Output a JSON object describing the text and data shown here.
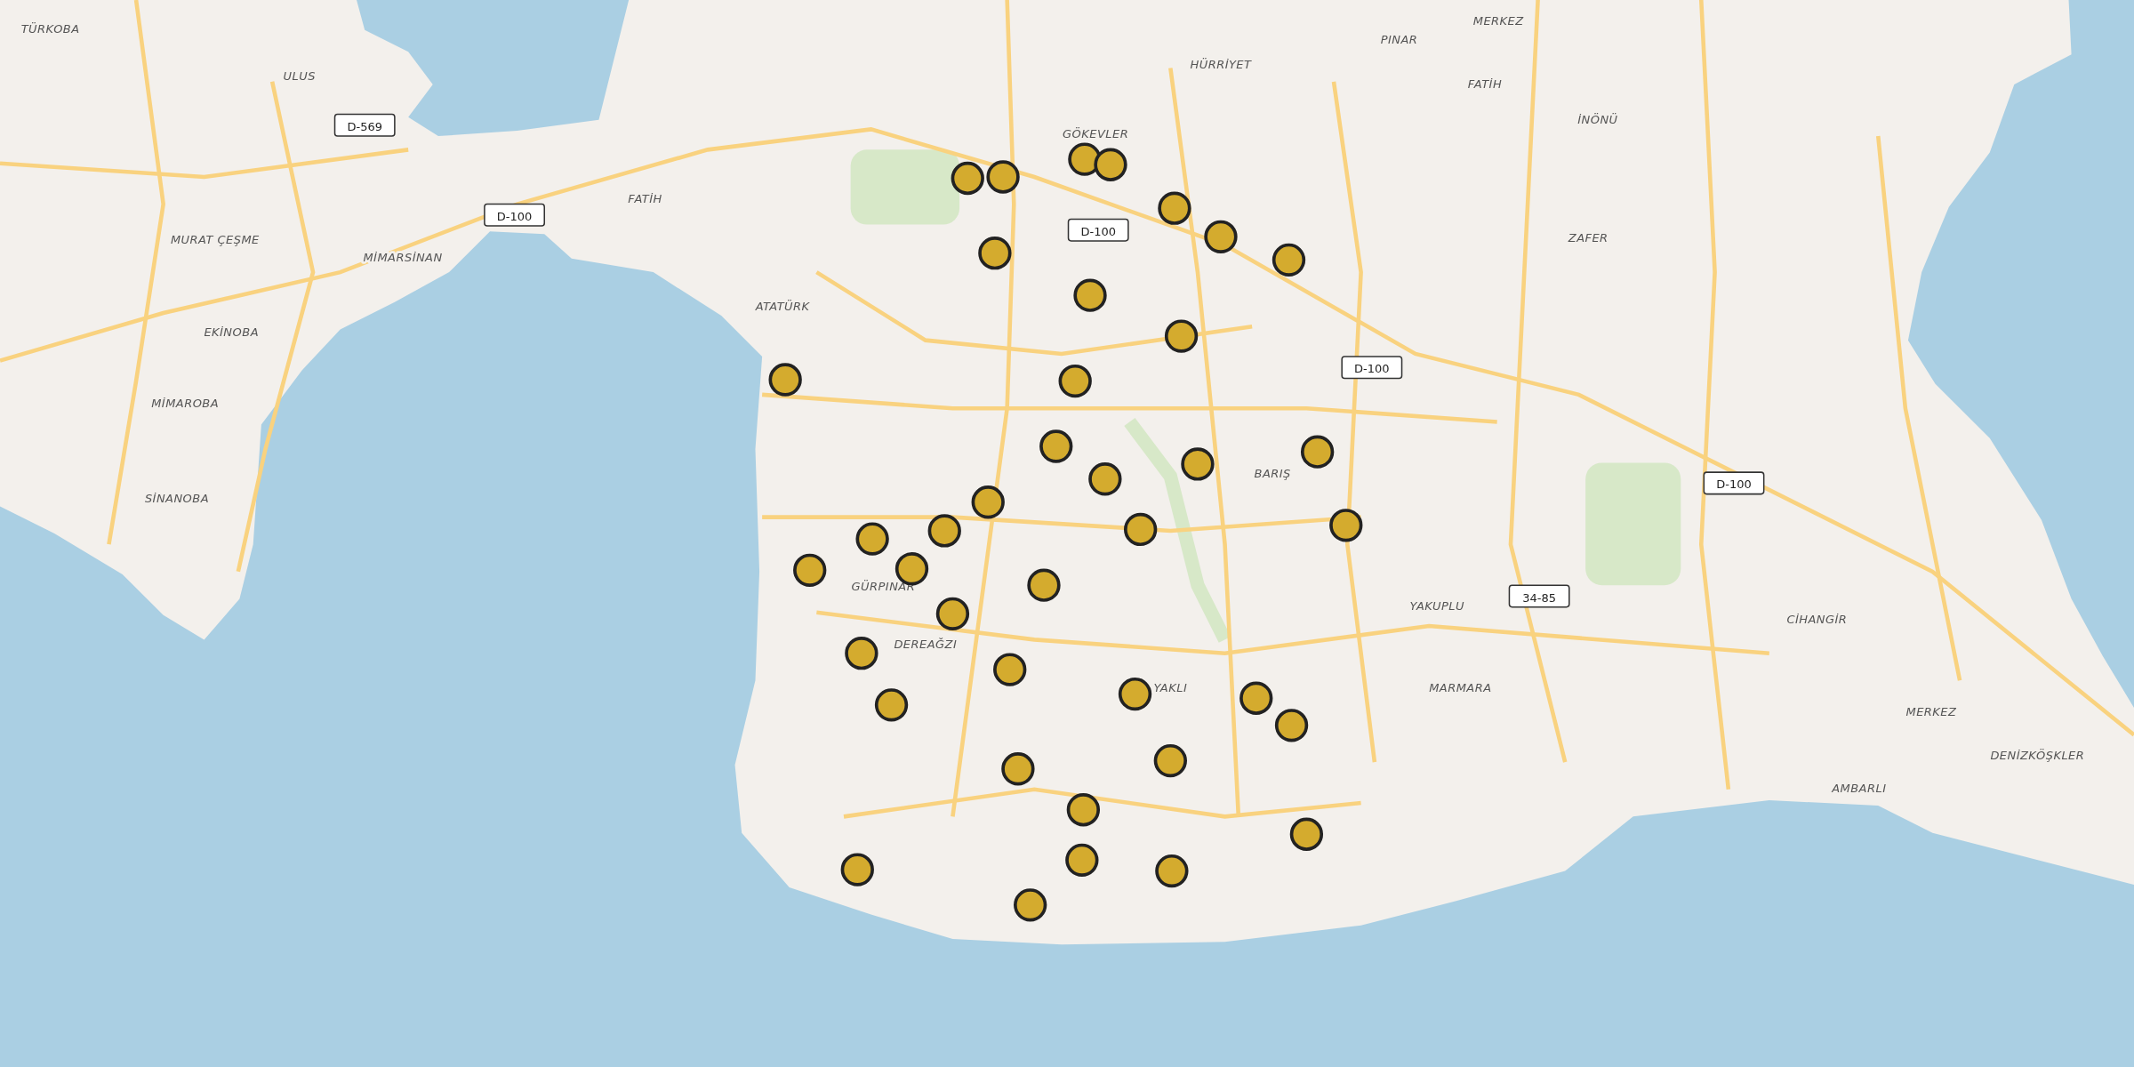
{
  "map": {
    "labels": [
      {
        "kind": "place",
        "text": "TÜRKOBA"
      },
      {
        "kind": "place",
        "text": "ULUS"
      },
      {
        "kind": "road",
        "text": "D-569"
      },
      {
        "kind": "place",
        "text": "MURAT ÇEŞME"
      },
      {
        "kind": "place",
        "text": "MİMARSİNAN"
      },
      {
        "kind": "road",
        "text": "D-100"
      },
      {
        "kind": "place",
        "text": "FATİH"
      },
      {
        "kind": "place",
        "text": "EKİNOBA"
      },
      {
        "kind": "place",
        "text": "ATATÜRK"
      },
      {
        "kind": "place",
        "text": "MİMAROBA"
      },
      {
        "kind": "place",
        "text": "SİNANOBA"
      },
      {
        "kind": "place",
        "text": "GÖKEVLER"
      },
      {
        "kind": "road",
        "text": "D-100"
      },
      {
        "kind": "place",
        "text": "HÜRRİYET"
      },
      {
        "kind": "place",
        "text": "PINAR"
      },
      {
        "kind": "place",
        "text": "MERKEZ"
      },
      {
        "kind": "place",
        "text": "FATİH"
      },
      {
        "kind": "place",
        "text": "İNÖNÜ"
      },
      {
        "kind": "place",
        "text": "ZAFER"
      },
      {
        "kind": "road",
        "text": "D-100"
      },
      {
        "kind": "place",
        "text": "BARIŞ"
      },
      {
        "kind": "road",
        "text": "D-100"
      },
      {
        "kind": "place",
        "text": "YAKUPLU"
      },
      {
        "kind": "road",
        "text": "34-85"
      },
      {
        "kind": "place",
        "text": "GÜRPINAR"
      },
      {
        "kind": "place",
        "text": "DEREAĞZI"
      },
      {
        "kind": "place",
        "text": "YAKLI"
      },
      {
        "kind": "place",
        "text": "MARMARA"
      },
      {
        "kind": "place",
        "text": "CİHANGİR"
      },
      {
        "kind": "place",
        "text": "MERKEZ"
      },
      {
        "kind": "place",
        "text": "DENİZKÖŞKLER"
      },
      {
        "kind": "place",
        "text": "AMBARLI"
      }
    ]
  }
}
